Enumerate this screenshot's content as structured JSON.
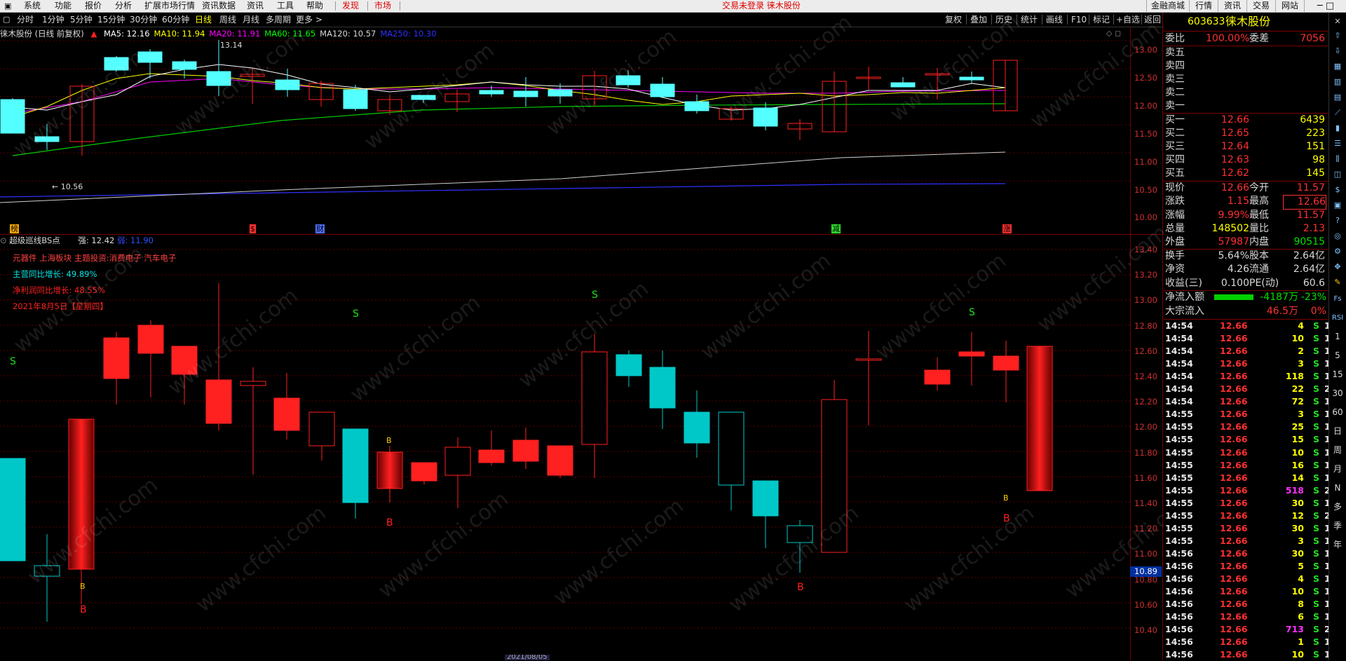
{
  "menu": {
    "items": [
      "系统",
      "功能",
      "报价",
      "分析",
      "扩展市场行情",
      "资讯数据",
      "资讯",
      "工具",
      "帮助"
    ],
    "tabs": [
      "发现",
      "市场"
    ],
    "status": "交易未登录  徕木股份",
    "right_buttons": [
      "金融商城",
      "行情",
      "资讯",
      "交易",
      "网站"
    ]
  },
  "toolbar": {
    "periods": [
      "分时",
      "1分钟",
      "5分钟",
      "15分钟",
      "30分钟",
      "60分钟",
      "日线",
      "周线",
      "月线",
      "多周期",
      "更多 >"
    ],
    "active_period": "日线",
    "tools": [
      "复权",
      "叠加",
      "历史",
      "统计",
      "画线",
      "F10",
      "标记",
      "+自选",
      "返回"
    ]
  },
  "main_chart": {
    "title": "徕木股份 (日线 前复权)",
    "ma": [
      {
        "label": "MA5: 12.16",
        "color": "#ffffff"
      },
      {
        "label": "MA10: 11.94",
        "color": "#ffff00"
      },
      {
        "label": "MA20: 11.91",
        "color": "#ff00ff"
      },
      {
        "label": "MA60: 11.65",
        "color": "#00ff00"
      },
      {
        "label": "MA120: 10.57",
        "color": "#d8d8d8"
      },
      {
        "label": "MA250: 10.30",
        "color": "#3030ff"
      }
    ],
    "high_label": "13.14",
    "low_label": "10.56",
    "markers": [
      "榜",
      "$",
      "财",
      "减",
      "涨"
    ],
    "y_ticks": [
      "13.00",
      "12.50",
      "12.00",
      "11.50",
      "11.00",
      "10.50",
      "10.00"
    ]
  },
  "indicator": {
    "title": "超级巡线BS点",
    "strong_label": "强: 12.42",
    "weak_label": "弱: 11.90",
    "notes": [
      {
        "text": "元器件 上海板块 主题投资:消费电子 汽车电子",
        "color": "#ff4040"
      },
      {
        "text": "主营同比增长: 49.89%",
        "color": "#00e5e5"
      },
      {
        "text": "净利润同比增长: 48.55%",
        "color": "#ff2020"
      },
      {
        "text": "2021年8月5日【星期四】",
        "color": "#ff2020"
      }
    ],
    "y_ticks": [
      "13.40",
      "13.20",
      "13.00",
      "12.80",
      "12.60",
      "12.40",
      "12.20",
      "12.00",
      "11.80",
      "11.60",
      "11.40",
      "11.20",
      "11.00",
      "10.80",
      "10.60",
      "10.40"
    ],
    "cursor_price": "10.89",
    "bottom_date": "2021/08/05"
  },
  "quote": {
    "code": "603633",
    "name": "徕木股份",
    "weibi_label": "委比",
    "weibi": "100.00%",
    "weicha_label": "委差",
    "weicha": "7056",
    "sells": [
      "卖五",
      "卖四",
      "卖三",
      "卖二",
      "卖一"
    ],
    "buys": [
      {
        "label": "买一",
        "price": "12.66",
        "vol": "6439"
      },
      {
        "label": "买二",
        "price": "12.65",
        "vol": "223"
      },
      {
        "label": "买三",
        "price": "12.64",
        "vol": "151"
      },
      {
        "label": "买四",
        "price": "12.63",
        "vol": "98"
      },
      {
        "label": "买五",
        "price": "12.62",
        "vol": "145"
      }
    ],
    "stats": [
      {
        "l1": "现价",
        "v1": "12.66",
        "c1": "#ff3030",
        "l2": "今开",
        "v2": "11.57",
        "c2": "#ff3030"
      },
      {
        "l1": "涨跌",
        "v1": "1.15",
        "c1": "#ff3030",
        "l2": "最高",
        "v2": "12.66",
        "c2": "#ff3030"
      },
      {
        "l1": "涨幅",
        "v1": "9.99%",
        "c1": "#ff3030",
        "l2": "最低",
        "v2": "11.57",
        "c2": "#ff3030"
      },
      {
        "l1": "总量",
        "v1": "148502",
        "c1": "#ffff00",
        "l2": "量比",
        "v2": "2.13",
        "c2": "#ff3030"
      },
      {
        "l1": "外盘",
        "v1": "57987",
        "c1": "#ff3030",
        "l2": "内盘",
        "v2": "90515",
        "c2": "#00e000"
      }
    ],
    "stats2": [
      {
        "l1": "换手",
        "v1": "5.64%",
        "l2": "股本",
        "v2": "2.64亿"
      },
      {
        "l1": "净资",
        "v1": "4.26",
        "l2": "流通",
        "v2": "2.64亿"
      },
      {
        "l1": "收益(三)",
        "v1": "0.100",
        "l2": "PE(动)",
        "v2": "60.6"
      }
    ],
    "flow": [
      {
        "label": "净流入额",
        "value": "-4187万",
        "pct": "-23%",
        "color": "#00e000"
      },
      {
        "label": "大宗流入",
        "value": "46.5万",
        "pct": "0%",
        "color": "#ff3030"
      }
    ]
  },
  "ticks": [
    {
      "t": "14:54",
      "p": "12.66",
      "v": "4",
      "s": "S",
      "n": "1"
    },
    {
      "t": "14:54",
      "p": "12.66",
      "v": "10",
      "s": "S",
      "n": "1"
    },
    {
      "t": "14:54",
      "p": "12.66",
      "v": "2",
      "s": "S",
      "n": "1"
    },
    {
      "t": "14:54",
      "p": "12.66",
      "v": "3",
      "s": "S",
      "n": "1"
    },
    {
      "t": "14:54",
      "p": "12.66",
      "v": "118",
      "s": "S",
      "n": "1"
    },
    {
      "t": "14:54",
      "p": "12.66",
      "v": "22",
      "s": "S",
      "n": "2"
    },
    {
      "t": "14:54",
      "p": "12.66",
      "v": "72",
      "s": "S",
      "n": "1"
    },
    {
      "t": "14:55",
      "p": "12.66",
      "v": "3",
      "s": "S",
      "n": "1"
    },
    {
      "t": "14:55",
      "p": "12.66",
      "v": "25",
      "s": "S",
      "n": "1"
    },
    {
      "t": "14:55",
      "p": "12.66",
      "v": "15",
      "s": "S",
      "n": "1"
    },
    {
      "t": "14:55",
      "p": "12.66",
      "v": "10",
      "s": "S",
      "n": "1"
    },
    {
      "t": "14:55",
      "p": "12.66",
      "v": "16",
      "s": "S",
      "n": "1"
    },
    {
      "t": "14:55",
      "p": "12.66",
      "v": "14",
      "s": "S",
      "n": "1"
    },
    {
      "t": "14:55",
      "p": "12.66",
      "v": "518",
      "s": "S",
      "n": "2"
    },
    {
      "t": "14:55",
      "p": "12.66",
      "v": "30",
      "s": "S",
      "n": "1"
    },
    {
      "t": "14:55",
      "p": "12.66",
      "v": "12",
      "s": "S",
      "n": "2"
    },
    {
      "t": "14:55",
      "p": "12.66",
      "v": "30",
      "s": "S",
      "n": "1"
    },
    {
      "t": "14:55",
      "p": "12.66",
      "v": "3",
      "s": "S",
      "n": "1"
    },
    {
      "t": "14:56",
      "p": "12.66",
      "v": "30",
      "s": "S",
      "n": "1"
    },
    {
      "t": "14:56",
      "p": "12.66",
      "v": "5",
      "s": "S",
      "n": "1"
    },
    {
      "t": "14:56",
      "p": "12.66",
      "v": "4",
      "s": "S",
      "n": "1"
    },
    {
      "t": "14:56",
      "p": "12.66",
      "v": "10",
      "s": "S",
      "n": "1"
    },
    {
      "t": "14:56",
      "p": "12.66",
      "v": "8",
      "s": "S",
      "n": "1"
    },
    {
      "t": "14:56",
      "p": "12.66",
      "v": "6",
      "s": "S",
      "n": "1"
    },
    {
      "t": "14:56",
      "p": "12.66",
      "v": "713",
      "s": "S",
      "n": "2"
    },
    {
      "t": "14:56",
      "p": "12.66",
      "v": "1",
      "s": "S",
      "n": "1"
    },
    {
      "t": "14:56",
      "p": "12.66",
      "v": "10",
      "s": "S",
      "n": "1"
    }
  ],
  "sidebar": [
    "Fs",
    "RSI",
    "1",
    "5",
    "15",
    "30",
    "60",
    "日",
    "周",
    "月",
    "N",
    "多",
    "季",
    "年"
  ],
  "watermark": "www.cfchi.com",
  "colors": {
    "up": "#ff2020",
    "down": "#00c8c8",
    "grid": "#7a0000"
  }
}
